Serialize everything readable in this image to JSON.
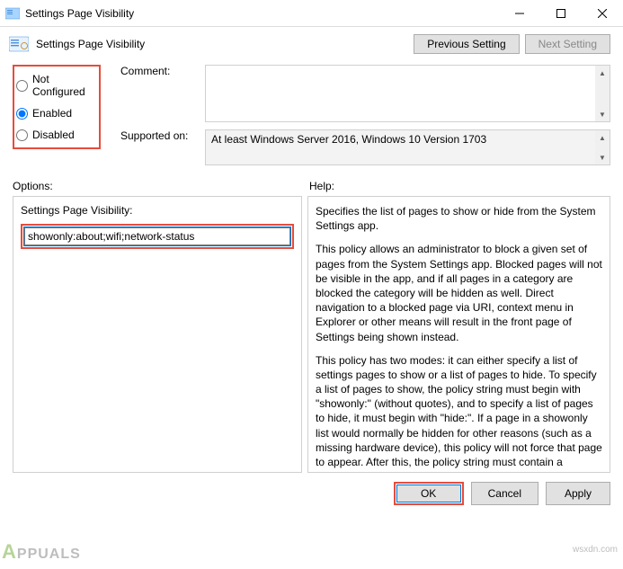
{
  "titlebar": {
    "title": "Settings Page Visibility"
  },
  "header": {
    "title": "Settings Page Visibility"
  },
  "nav": {
    "prev": "Previous Setting",
    "next": "Next Setting"
  },
  "radios": {
    "not_configured": "Not Configured",
    "enabled": "Enabled",
    "disabled": "Disabled"
  },
  "fields": {
    "comment_label": "Comment:",
    "comment_value": "",
    "supported_label": "Supported on:",
    "supported_value": "At least Windows Server 2016, Windows 10 Version 1703"
  },
  "labels": {
    "options": "Options:",
    "help": "Help:"
  },
  "option": {
    "label": "Settings Page Visibility:",
    "value": "showonly:about;wifi;network-status"
  },
  "help": {
    "p1": "Specifies the list of pages to show or hide from the System Settings app.",
    "p2": "This policy allows an administrator to block a given set of pages from the System Settings app. Blocked pages will not be visible in the app, and if all pages in a category are blocked the category will be hidden as well. Direct navigation to a blocked page via URI, context menu in Explorer or other means will result in the front page of Settings being shown instead.",
    "p3": "This policy has two modes: it can either specify a list of settings pages to show or a list of pages to hide. To specify a list of pages to show, the policy string must begin with \"showonly:\" (without quotes), and to specify a list of pages to hide, it must begin with \"hide:\". If a page in a showonly list would normally be hidden for other reasons (such as a missing hardware device), this policy will not force that page to appear. After this, the policy string must contain a semicolon-delimited list of settings page identifiers. The identifier for any given settings page is the published URI for that page, minus the \"ms-settings:\" protocol part."
  },
  "footer": {
    "ok": "OK",
    "cancel": "Cancel",
    "apply": "Apply"
  },
  "watermark": {
    "brand": "PPUALS",
    "site": "wsxdn.com"
  },
  "colors": {
    "highlight": "#e74c3c",
    "focus": "#0078d7"
  }
}
